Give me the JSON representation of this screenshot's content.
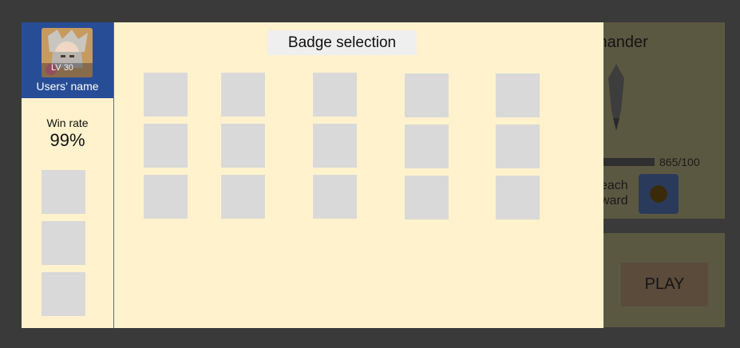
{
  "background_screen": {
    "title_partial": "mander",
    "progress_text": "865/100",
    "progress_fraction": 1.0,
    "reach_line1": "each",
    "reach_line2": "ward",
    "reward_icon": "gold-medallion-icon",
    "play_label": "PLAY"
  },
  "profile": {
    "avatar_level": "LV 30",
    "name": "Users’ name",
    "win_rate_label": "Win rate",
    "win_rate_value": "99%",
    "equipped_slots": 3
  },
  "badge_panel": {
    "title": "Badge selection",
    "rows": 3,
    "columns": 5
  },
  "colors": {
    "modal_bg": "#fff2cd",
    "profile_header_bg": "#274d97",
    "slot_bg": "#d9d9d9",
    "title_bg": "#efefef"
  }
}
